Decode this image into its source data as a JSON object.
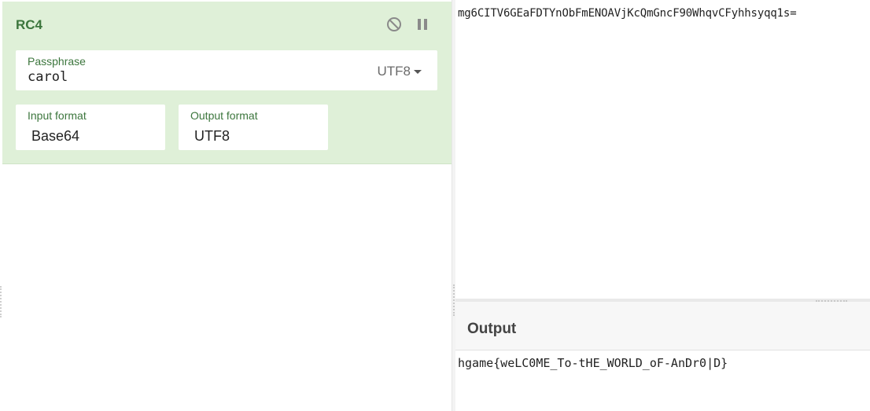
{
  "operation": {
    "title": "RC4",
    "controls": [
      {
        "name": "disable-icon"
      },
      {
        "name": "pause-icon"
      }
    ],
    "passphrase": {
      "label": "Passphrase",
      "value": "carol",
      "encoding": "UTF8"
    },
    "input_format": {
      "label": "Input format",
      "value": "Base64"
    },
    "output_format": {
      "label": "Output format",
      "value": "UTF8"
    }
  },
  "input": {
    "text": "mg6CITV6GEaFDTYnObFmENOAVjKcQmGncF90WhqvCFyhhsyqq1s="
  },
  "output": {
    "title": "Output",
    "text": "hgame{weLC0ME_To-tHE_WORLD_oF-AnDr0|D}"
  },
  "colors": {
    "accent_green": "#3c763d",
    "card_bg": "#dff0d8"
  }
}
